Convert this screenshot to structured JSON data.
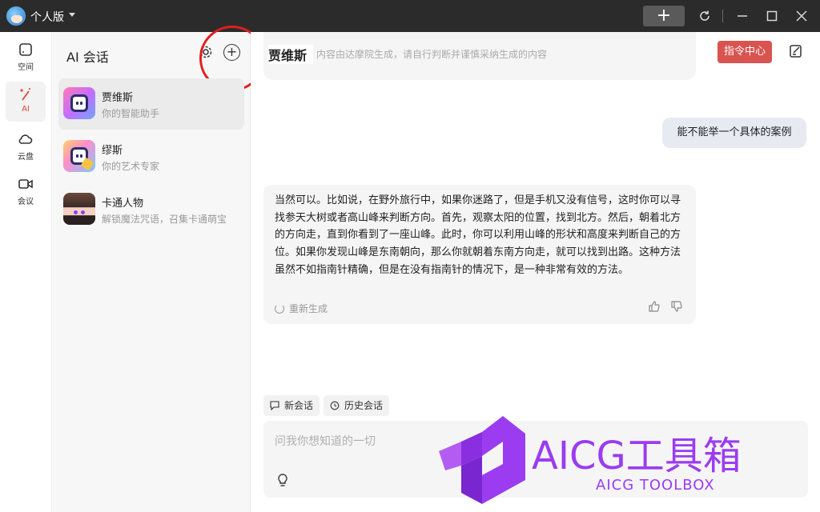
{
  "titlebar": {
    "edition_label": "个人版"
  },
  "rail": {
    "items": [
      {
        "label": "空间",
        "icon": "square-icon"
      },
      {
        "label": "AI",
        "icon": "magic-wand-icon"
      },
      {
        "label": "云盘",
        "icon": "cloud-icon"
      },
      {
        "label": "会议",
        "icon": "video-camera-icon"
      }
    ],
    "active_index": 1
  },
  "sessions": {
    "title": "AI 会话",
    "items": [
      {
        "name": "贾维斯",
        "desc": "你的智能助手"
      },
      {
        "name": "缪斯",
        "desc": "你的艺术专家"
      },
      {
        "name": "卡通人物",
        "desc": "解锁魔法咒语，召集卡通萌宝"
      }
    ]
  },
  "chat": {
    "title": "贾维斯",
    "subtitle": "内容由达摩院生成，请自行判断并谨慎采纳生成的内容",
    "command_center": "指令中心",
    "user_message": "能不能举一个具体的案例",
    "ai_message": "当然可以。比如说，在野外旅行中，如果你迷路了，但是手机又没有信号，这时你可以寻找参天大树或者高山峰来判断方向。首先，观察太阳的位置，找到北方。然后，朝着北方的方向走，直到你看到了一座山峰。此时，你可以利用山峰的形状和高度来判断自己的方位。如果你发现山峰是东南朝向，那么你就朝着东南方向走，就可以找到出路。这种方法虽然不如指南针精确，但是在没有指南针的情况下，是一种非常有效的方法。",
    "regenerate": "重新生成",
    "new_session": "新会话",
    "history": "历史会话",
    "input_placeholder": "问我你想知道的一切"
  },
  "watermark": {
    "title": "AICG工具箱",
    "subtitle": "AICG TOOLBOX"
  },
  "colors": {
    "accent_red": "#d9534f",
    "annotation_circle": "#e21e1e",
    "watermark_purple": "#9b3cf0"
  }
}
